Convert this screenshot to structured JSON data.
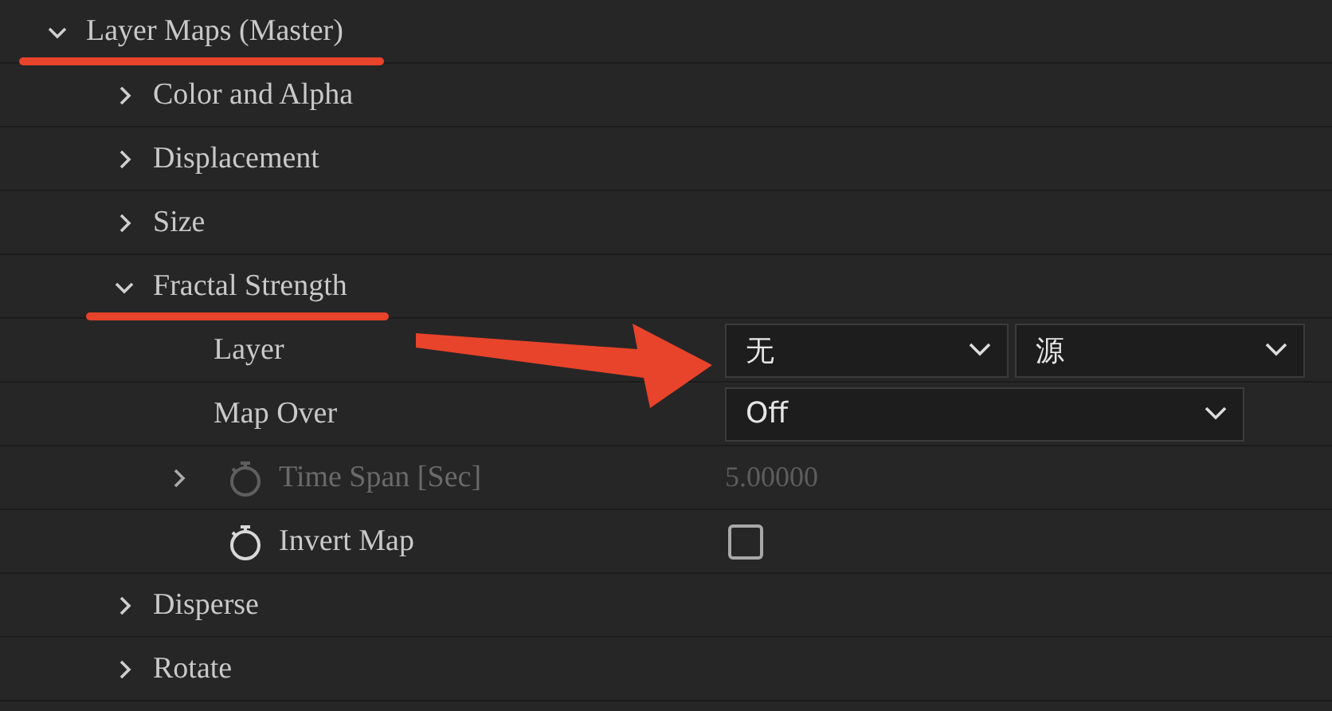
{
  "tree": [
    {
      "label": "Layer Maps (Master)",
      "expanded": true,
      "underlined": true,
      "children": [
        {
          "label": "Color and Alpha",
          "expanded": false,
          "underlined": false
        },
        {
          "label": "Displacement",
          "expanded": false,
          "underlined": false
        },
        {
          "label": "Size",
          "expanded": false,
          "underlined": false
        },
        {
          "label": "Fractal Strength",
          "expanded": true,
          "underlined": true,
          "properties": [
            {
              "kind": "dropdowns",
              "label": "Layer",
              "values": [
                "无",
                "源"
              ]
            },
            {
              "kind": "dropdown",
              "label": "Map Over",
              "value": "Off"
            },
            {
              "kind": "number",
              "label": "Time Span [Sec]",
              "value": "5.00000",
              "disabled": true,
              "expanded": false
            },
            {
              "kind": "checkbox",
              "label": "Invert Map",
              "checked": false,
              "disabled": false
            }
          ]
        },
        {
          "label": "Disperse",
          "expanded": false,
          "underlined": false
        },
        {
          "label": "Rotate",
          "expanded": false,
          "underlined": false
        }
      ]
    }
  ],
  "annotations": [
    {
      "kind": "arrow"
    }
  ]
}
